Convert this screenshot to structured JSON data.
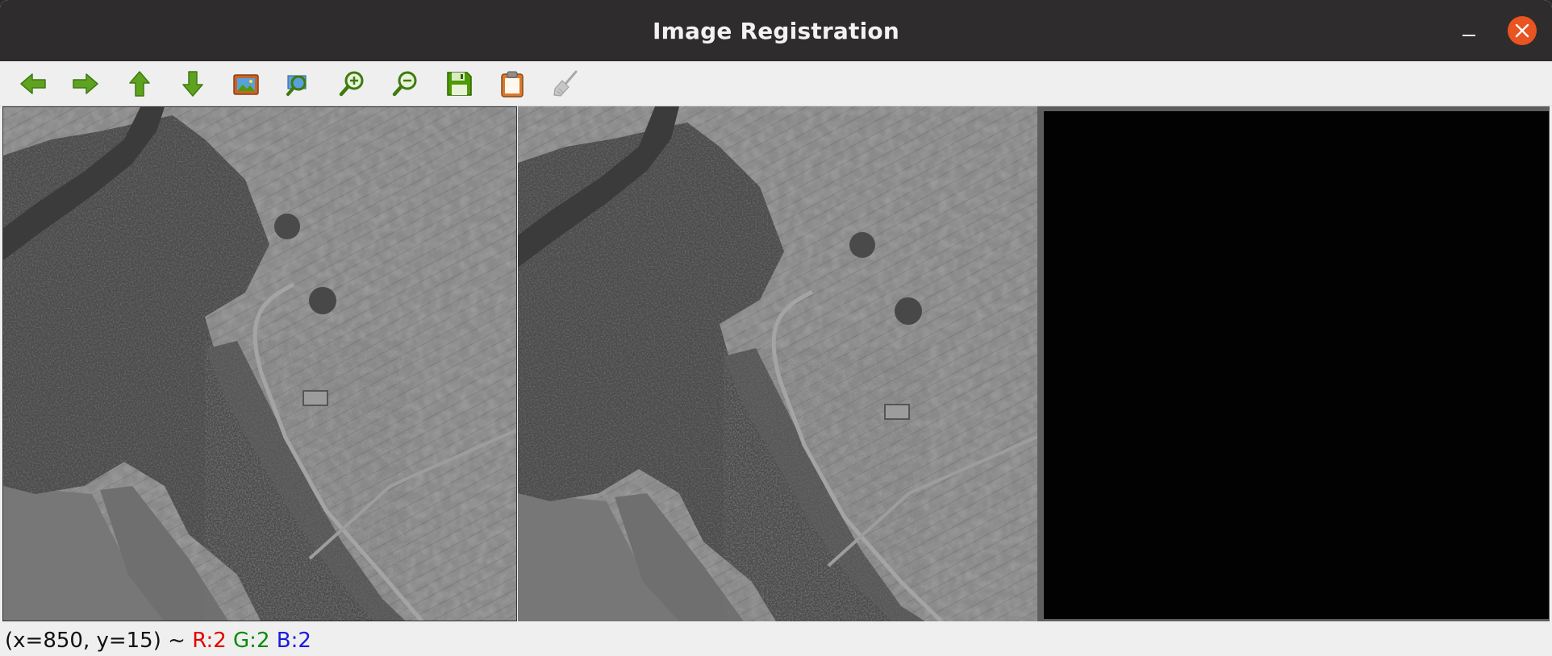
{
  "window": {
    "title": "Image Registration"
  },
  "colors": {
    "accent_close": "#e95420",
    "icon_green": "#4e9a06"
  },
  "toolbar": {
    "buttons": [
      {
        "name": "back-button",
        "icon": "left-arrow-icon"
      },
      {
        "name": "forward-button",
        "icon": "right-arrow-icon"
      },
      {
        "name": "up-button",
        "icon": "up-arrow-icon"
      },
      {
        "name": "down-button",
        "icon": "down-arrow-icon"
      },
      {
        "name": "image-button",
        "icon": "picture-icon"
      },
      {
        "name": "zoom-fit-button",
        "icon": "zoom-fit-icon"
      },
      {
        "name": "zoom-in-button",
        "icon": "zoom-in-icon"
      },
      {
        "name": "zoom-out-button",
        "icon": "zoom-out-icon"
      },
      {
        "name": "save-button",
        "icon": "floppy-disk-icon"
      },
      {
        "name": "clipboard-button",
        "icon": "clipboard-icon"
      },
      {
        "name": "clear-button",
        "icon": "broom-icon",
        "disabled": true
      }
    ]
  },
  "status": {
    "coords": "(x=850, y=15) ~ ",
    "r": "R:2",
    "g": "G:2",
    "b": "B:2"
  }
}
